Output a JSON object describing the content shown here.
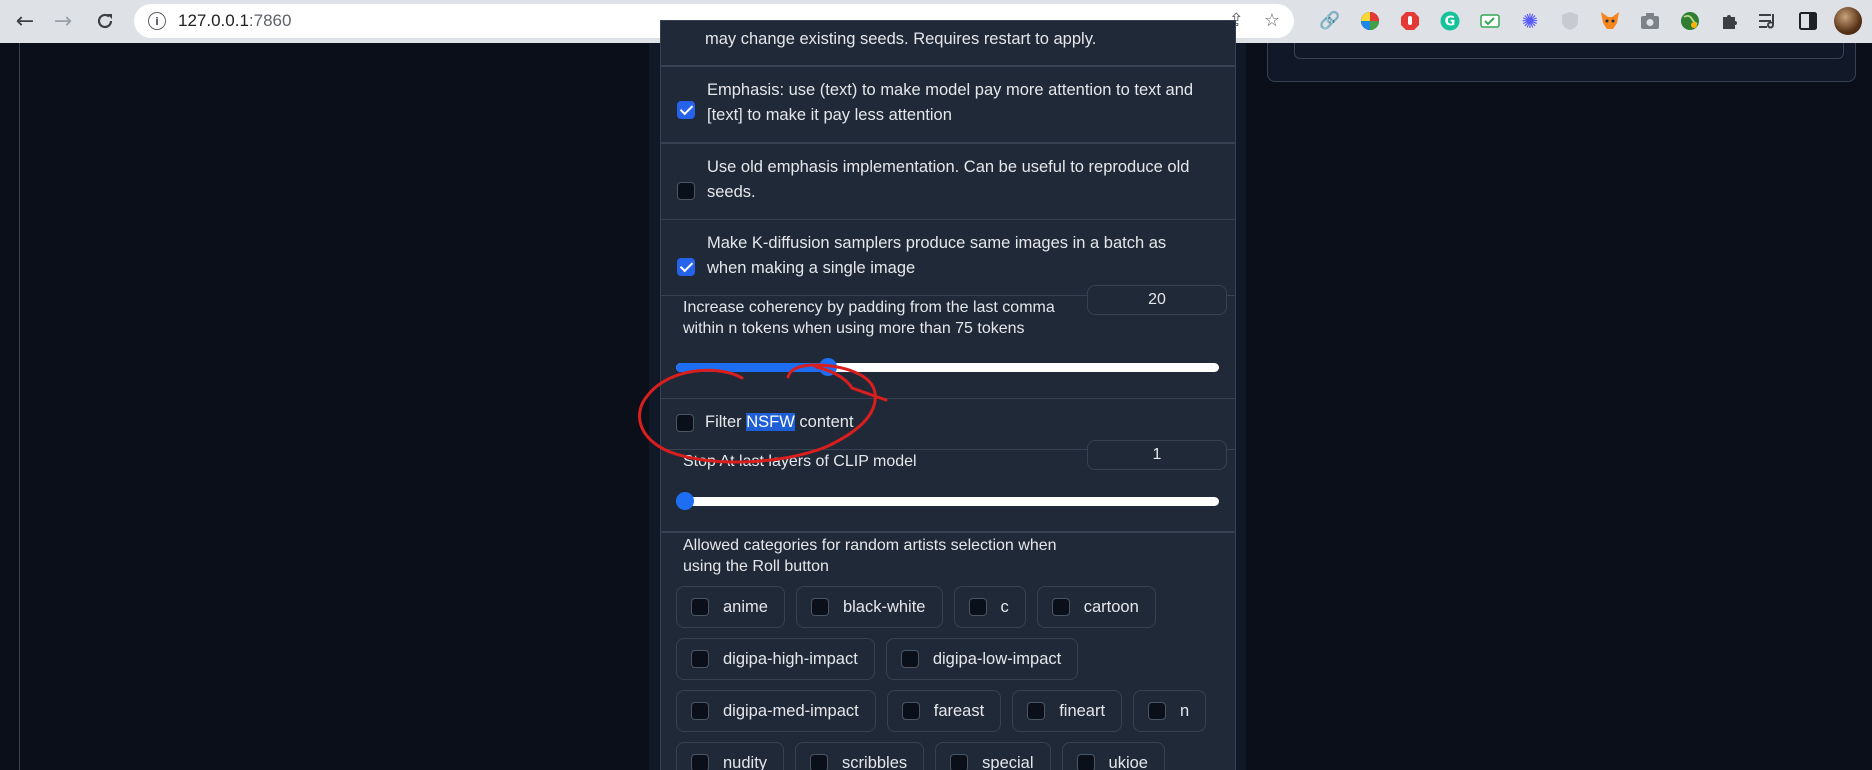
{
  "browser": {
    "url_host": "127.0.0.1",
    "url_port": ":7860"
  },
  "settings": {
    "partial_top": "may change existing seeds. Requires restart to apply.",
    "emphasis": {
      "label": "Emphasis: use (text) to make model pay more attention to text and [text] to make it pay less attention",
      "checked": true
    },
    "old_emphasis": {
      "label": "Use old emphasis implementation. Can be useful to reproduce old seeds.",
      "checked": false
    },
    "kdiffusion": {
      "label": "Make K-diffusion samplers produce same images in a batch as when making a single image",
      "checked": true
    },
    "comma_padding": {
      "label": "Increase coherency by padding from the last comma within n tokens when using more than 75 tokens",
      "value": "20",
      "fraction": 0.28
    },
    "nsfw": {
      "label_prefix": "Filter ",
      "label_highlight": "NSFW",
      "label_suffix": " content",
      "checked": false
    },
    "clip_skip": {
      "label": "Stop At last layers of CLIP model",
      "value": "1",
      "fraction": 0.0
    },
    "artists": {
      "label": "Allowed categories for random artists selection when using the Roll button",
      "categories": [
        "anime",
        "black-white",
        "c",
        "cartoon",
        "digipa-high-impact",
        "digipa-low-impact",
        "digipa-med-impact",
        "fareast",
        "fineart",
        "n",
        "nudity",
        "scribbles",
        "special",
        "ukioe"
      ]
    }
  },
  "colors": {
    "accent": "#1d6ef2",
    "annotation": "#d91e1e",
    "checkbox_on": "#2563eb"
  }
}
